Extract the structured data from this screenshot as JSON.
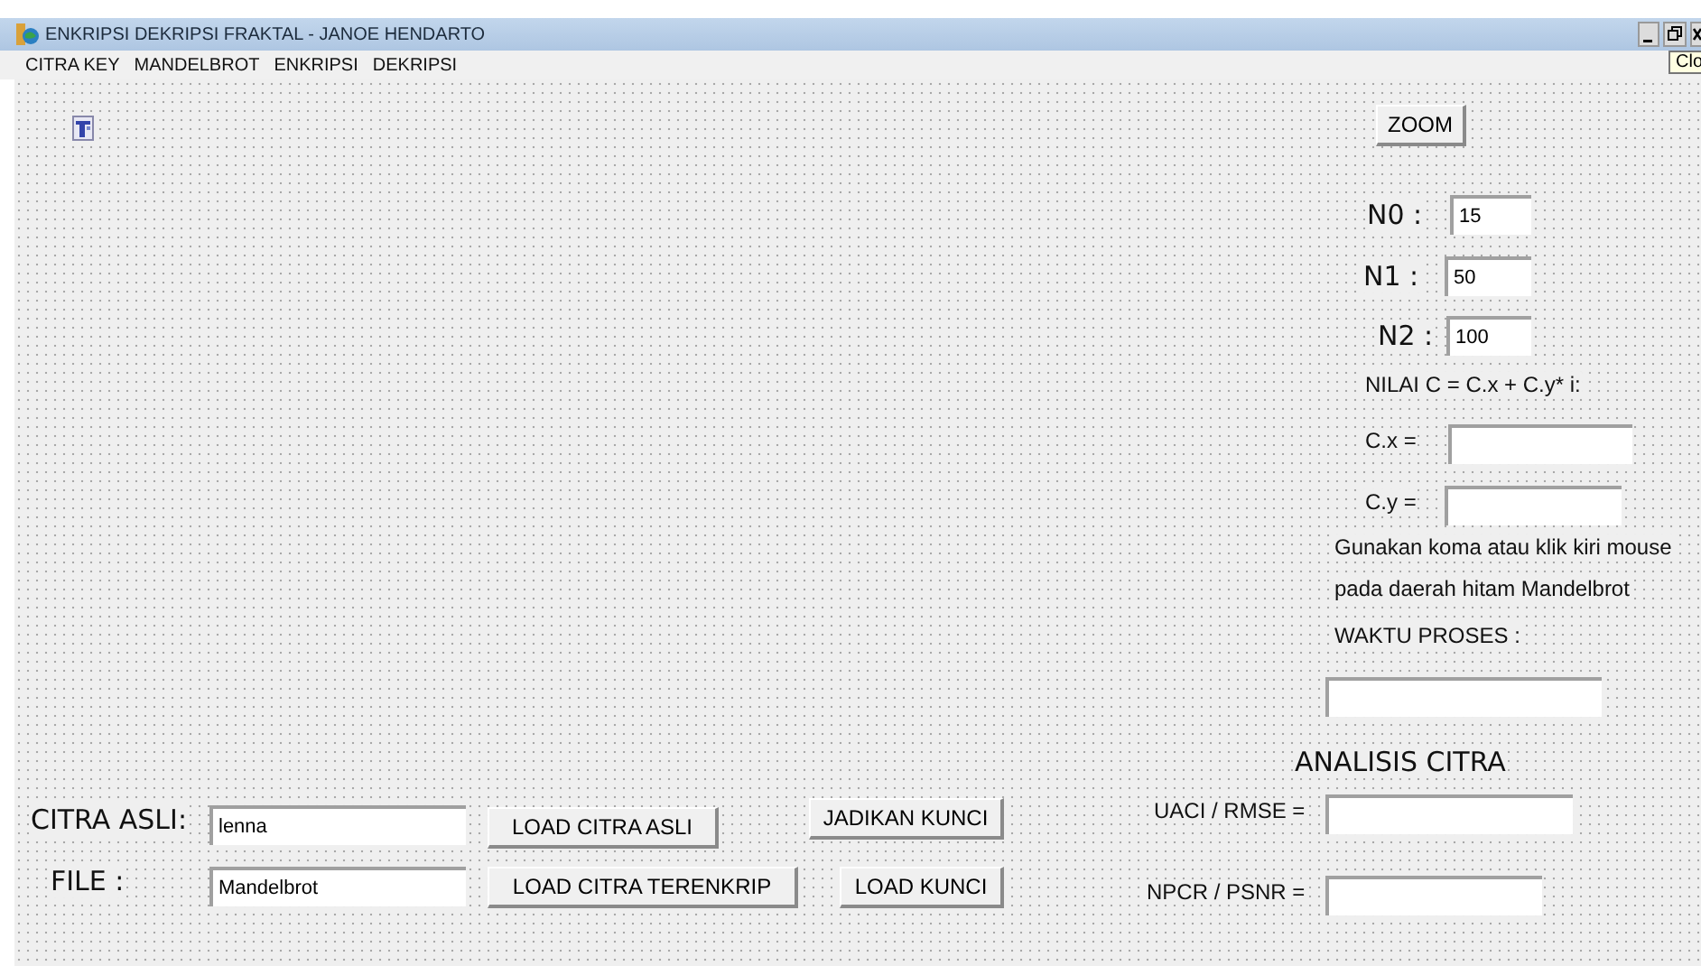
{
  "window": {
    "title": "ENKRIPSI DEKRIPSI FRAKTAL - JANOE HENDARTO"
  },
  "menu": [
    "CITRA KEY",
    "MANDELBROT",
    "ENKRIPSI",
    "DEKRIPSI"
  ],
  "tooltip": "Clo",
  "zoom_button": "ZOOM",
  "params": [
    {
      "label": "N0  :",
      "value": "15"
    },
    {
      "label": "N1 :",
      "value": "50"
    },
    {
      "label": "N2 :",
      "value": "100"
    }
  ],
  "formula": "NILAI C = C.x + C.y* i:",
  "c_fields": [
    {
      "label": "C.x  ="
    },
    {
      "label": "C.y  ="
    }
  ],
  "hint_lines": [
    "Gunakan koma  atau  klik kiri mouse",
    "pada daerah hitam Mandelbrot"
  ],
  "process_time_label": "WAKTU PROSES :",
  "analysis": {
    "title": "ANALISIS  CITRA",
    "fields": [
      {
        "label": "UACI / RMSE ="
      },
      {
        "label": "NPCR / PSNR ="
      }
    ]
  },
  "inputs": [
    {
      "label": "CITRA ASLI:",
      "value": "lenna"
    },
    {
      "label": "FILE :",
      "value": "Mandelbrot"
    }
  ],
  "buttons": [
    "LOAD CITRA ASLI",
    "LOAD CITRA TERENKRIP",
    "JADIKAN KUNCI",
    "LOAD KUNCI"
  ]
}
